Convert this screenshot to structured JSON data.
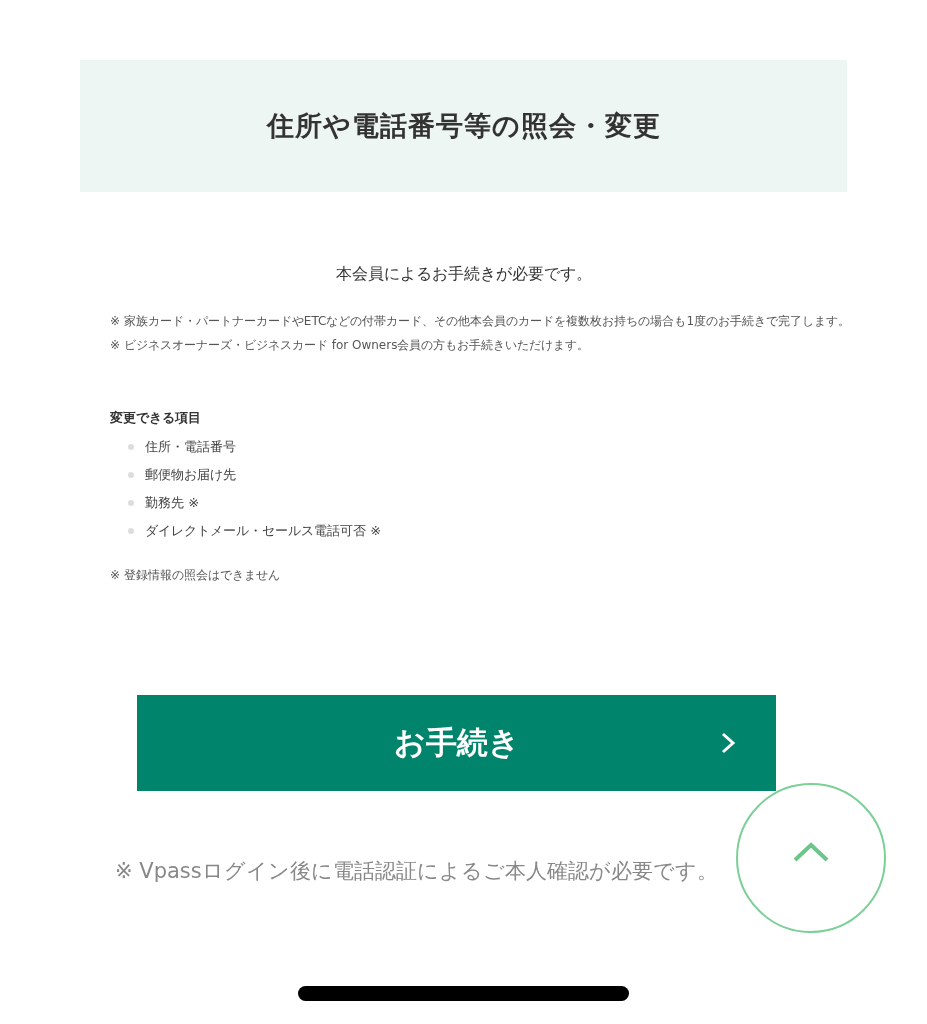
{
  "header": {
    "title": "住所や電話番号等の照会・変更"
  },
  "lead": "本会員によるお手続きが必要です。",
  "notes": [
    "※ 家族カード・パートナーカードやETCなどの付帯カード、その他本会員のカードを複数枚お持ちの場合も1度のお手続きで完了します。",
    "※ ビジネスオーナーズ・ビジネスカード for Owners会員の方もお手続きいただけます。"
  ],
  "changeable": {
    "heading": "変更できる項目",
    "items": [
      "住所・電話番号",
      "郵便物お届け先",
      "勤務先 ※",
      "ダイレクトメール・セールス電話可否 ※"
    ],
    "note": "※ 登録情報の照会はできません"
  },
  "procedure_button": {
    "label": "お手続き"
  },
  "login_note": "※ Vpassログイン後に電話認証によるご本人確認が必要です。"
}
